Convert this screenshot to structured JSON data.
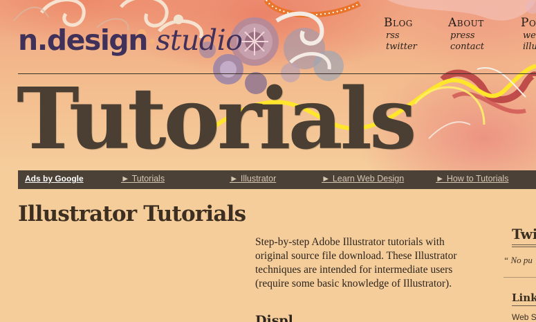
{
  "logo": {
    "part1": "n.design",
    "part2": " studio"
  },
  "nav": [
    {
      "label": "Blog",
      "subs": [
        "rss",
        "twitter"
      ]
    },
    {
      "label": "About",
      "subs": [
        "press",
        "contact"
      ]
    },
    {
      "label": "Po",
      "subs": [
        "we",
        "illu"
      ]
    }
  ],
  "hero": {
    "title": "Tutorials"
  },
  "ads": {
    "label": "Ads by Google",
    "links": [
      "► Tutorials",
      "► Illustrator",
      "► Learn Web Design",
      "► How to Tutorials"
    ]
  },
  "main": {
    "title": "Illustrator Tutorials",
    "intro": "Step-by-step Adobe Illustrator tutorials with original source file download. These Illustrator techniques are intended for intermediate users (require some basic knowledge of Illustrator).",
    "next_heading": "Displ"
  },
  "sidebar": {
    "heading1": "Twi",
    "quote": "“ No pu",
    "heading2": "Links",
    "text": "Web S"
  },
  "colors": {
    "background": "#f5cd9b",
    "adbar": "#4b4137",
    "logo": "#40315a",
    "title": "#4a3f32"
  }
}
